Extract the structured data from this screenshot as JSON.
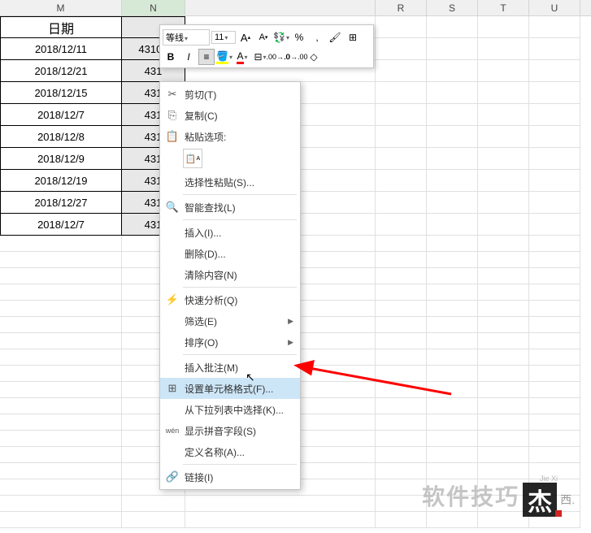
{
  "columns": [
    "M",
    "N",
    "",
    "R",
    "S",
    "T",
    "U"
  ],
  "table": {
    "header_m": "日期",
    "header_n": "",
    "rows": [
      {
        "date": "2018/12/11",
        "val": "43104"
      },
      {
        "date": "2018/12/21",
        "val": "431"
      },
      {
        "date": "2018/12/15",
        "val": "431"
      },
      {
        "date": "2018/12/7",
        "val": "431"
      },
      {
        "date": "2018/12/8",
        "val": "431"
      },
      {
        "date": "2018/12/9",
        "val": "431"
      },
      {
        "date": "2018/12/19",
        "val": "431"
      },
      {
        "date": "2018/12/27",
        "val": "431"
      },
      {
        "date": "2018/12/7",
        "val": "431"
      }
    ]
  },
  "mini_toolbar": {
    "font_name": "等线",
    "font_size": "11",
    "increase_font": "A",
    "decrease_font": "A",
    "bold": "B",
    "italic": "I",
    "percent": "%",
    "comma": ","
  },
  "context_menu": {
    "cut": "剪切(T)",
    "copy": "复制(C)",
    "paste_options": "粘贴选项:",
    "paste_special": "选择性粘贴(S)...",
    "smart_lookup": "智能查找(L)",
    "insert": "插入(I)...",
    "delete": "删除(D)...",
    "clear": "清除内容(N)",
    "quick_analysis": "快速分析(Q)",
    "filter": "筛选(E)",
    "sort": "排序(O)",
    "insert_comment": "插入批注(M)",
    "format_cells": "设置单元格格式(F)...",
    "pick_from_list": "从下拉列表中选择(K)...",
    "show_phonetic": "显示拼音字段(S)",
    "define_name": "定义名称(A)...",
    "hyperlink": "链接(I)"
  },
  "watermark": {
    "text": "软件技巧",
    "logo": "杰",
    "sub": "西.",
    "pinyin": "Jie Xi"
  }
}
